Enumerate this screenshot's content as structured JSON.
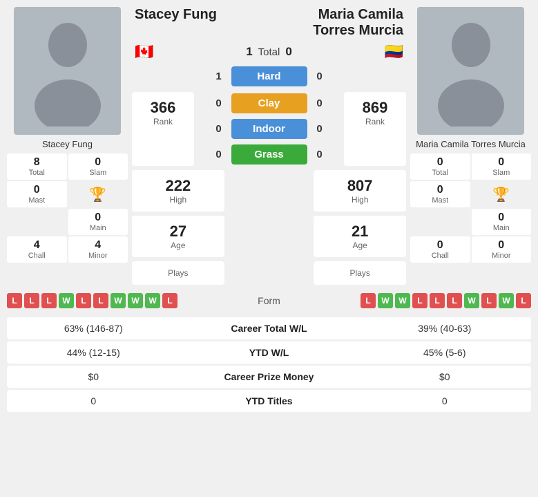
{
  "players": {
    "left": {
      "name": "Stacey Fung",
      "flag": "🇨🇦",
      "stats": {
        "total": "8",
        "slam": "0",
        "mast": "0",
        "main": "0",
        "chall": "4",
        "minor": "4"
      },
      "rank": "366",
      "high": "222",
      "age": "27",
      "plays": ""
    },
    "right": {
      "name": "Maria Camila Torres Murcia",
      "flag": "🇨🇴",
      "stats": {
        "total": "0",
        "slam": "0",
        "mast": "0",
        "main": "0",
        "chall": "0",
        "minor": "0"
      },
      "rank": "869",
      "high": "807",
      "age": "21",
      "plays": ""
    }
  },
  "center": {
    "total_label": "Total",
    "left_total": "1",
    "right_total": "0",
    "surfaces": [
      {
        "label": "Hard",
        "color": "hard",
        "left": "1",
        "right": "0"
      },
      {
        "label": "Clay",
        "color": "clay",
        "left": "0",
        "right": "0"
      },
      {
        "label": "Indoor",
        "color": "indoor",
        "left": "0",
        "right": "0"
      },
      {
        "label": "Grass",
        "color": "grass",
        "left": "0",
        "right": "0"
      }
    ]
  },
  "form": {
    "label": "Form",
    "left": [
      "L",
      "L",
      "L",
      "W",
      "L",
      "L",
      "W",
      "W",
      "W",
      "L"
    ],
    "right": [
      "L",
      "W",
      "W",
      "L",
      "L",
      "L",
      "W",
      "L",
      "W",
      "L"
    ]
  },
  "bottom_stats": [
    {
      "left": "63% (146-87)",
      "label": "Career Total W/L",
      "right": "39% (40-63)"
    },
    {
      "left": "44% (12-15)",
      "label": "YTD W/L",
      "right": "45% (5-6)"
    },
    {
      "left": "$0",
      "label": "Career Prize Money",
      "right": "$0"
    },
    {
      "left": "0",
      "label": "YTD Titles",
      "right": "0"
    }
  ],
  "labels": {
    "total": "Total",
    "slam": "Slam",
    "mast": "Mast",
    "main": "Main",
    "chall": "Chall",
    "minor": "Minor",
    "rank": "Rank",
    "high": "High",
    "age": "Age",
    "plays": "Plays"
  }
}
